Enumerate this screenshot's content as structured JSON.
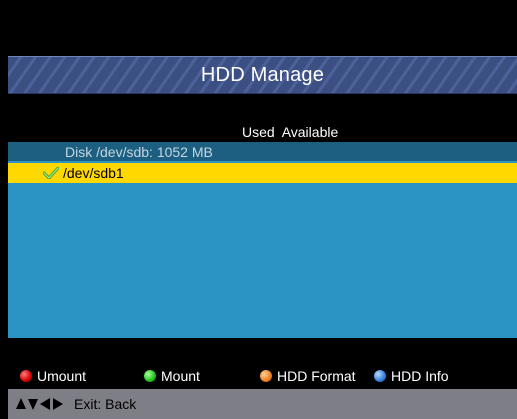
{
  "title": "HDD Manage",
  "columns": "Used  Available",
  "disk": {
    "label": "Disk /dev/sdb: 1052 MB"
  },
  "partitions": [
    {
      "label": "/dev/sdb1",
      "selected": true,
      "icon": "checkmark-icon"
    }
  ],
  "colors": {
    "selected_row": "#ffd800",
    "list_bg": "#2c93c5",
    "disk_row": "#1d5f80",
    "title_bar": "#3b4f82"
  },
  "buttons": [
    {
      "label": "Umount",
      "color": "red"
    },
    {
      "label": "Mount",
      "color": "green"
    },
    {
      "label": "HDD Format",
      "color": "orange"
    },
    {
      "label": "HDD Info",
      "color": "blue"
    }
  ],
  "nav": {
    "exit_label": "Exit: Back",
    "icon": "navigation-arrows-icon"
  }
}
